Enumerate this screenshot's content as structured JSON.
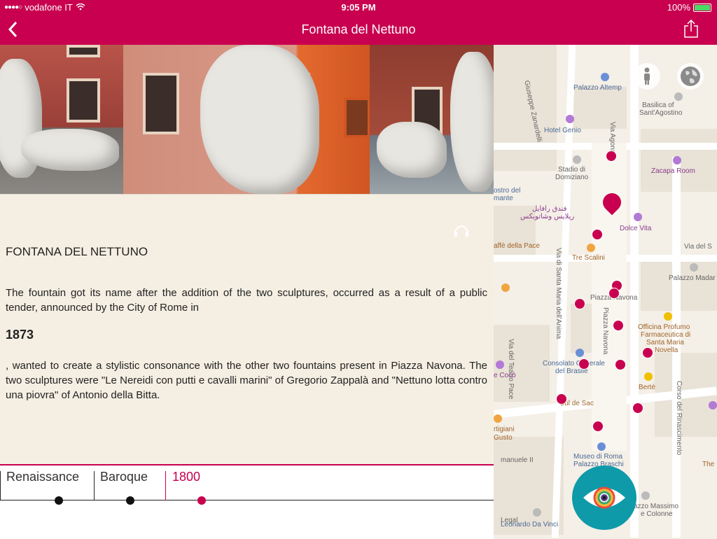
{
  "status": {
    "carrier": "vodafone IT",
    "time": "9:05 PM",
    "battery": "100%",
    "battery_level": 1.0
  },
  "nav": {
    "back_icon": "chevron-left-icon",
    "title": "Fontana del Nettuno",
    "share_icon": "share-icon"
  },
  "content": {
    "heading": "FONTANA DEL NETTUNO",
    "para1": "The fountain got its name after the addition of the two sculptures, occurred as a result of a public tender, announced by the City of Rome in",
    "year": "1873",
    "para2": ", wanted to create a stylistic consonance with the other two fountains present in Piazza Navona. The two sculptures were \"Le Nereidi con putti e cavalli marini\" of Gregorio Zappalà and \"Nettuno lotta contro una piovra\" of Antonio della Bitta."
  },
  "timeline": {
    "periods": [
      {
        "label": "Renaissance",
        "active": false
      },
      {
        "label": "Baroque",
        "active": false
      },
      {
        "label": "1800",
        "active": true
      }
    ]
  },
  "map": {
    "labels": {
      "palazzo_altemps": "Palazzo Altemp",
      "basilica": "Basilica of",
      "basilica2": "Sant'Agostino",
      "hotel_genio": "Hotel Genio",
      "stadio": "Stadio di",
      "stadio2": "Domiziano",
      "zacapa": "Zacapa Room",
      "museo_nostro": "ostro del",
      "museo_nostro2": "mante",
      "arabic1": "فندق رافايل",
      "arabic2": "ريلايس وشاتوبكس",
      "dolce_vita": "Dolce Vita",
      "caffe_pace": "affè della Pace",
      "tre_scalini": "Tre Scalini",
      "via_del_s": "Via del S",
      "palazzo_madama": "Palazzo Madar",
      "piazza_navona": "Piazza Navona",
      "officina1": "Officina Profumo",
      "officina2": "Farmaceutica di",
      "officina3": "Santa Maria",
      "officina4": "Novella",
      "consolato1": "Consolato Generale",
      "consolato2": "del Brasile",
      "e_coco": "e Cocò",
      "berte": "Berté",
      "cul_de_sac": "Cul de Sac",
      "artigiani1": "rtigiani",
      "artigiani2": "Gusto",
      "manuele": "manuele II",
      "museo_roma1": "Museo di Roma",
      "museo_roma2": "Palazzo Braschi",
      "the": "The",
      "massimo1": "azzo Massimo",
      "massimo2": "e Colonne",
      "leonardo": "Leonardo Da Vinci",
      "legal": "Legal",
      "via_aponale": "Via Agonale",
      "via_zanardelli": "Giuseppe Zanardelli",
      "via_santa_maria": "Via di Santa Maria dell'Anima",
      "corso_rinascimento": "Corso del Rinascimento",
      "via_teatro_pace": "Via del Teatro Pace",
      "piazza_navona_street": "Piazza Navona"
    },
    "person_icon": "person-icon",
    "globe_icon": "globe-icon"
  },
  "fab": {
    "icon": "eye-icon"
  },
  "colors": {
    "brand": "#c8004f",
    "fab": "#0f9aa9",
    "content_bg": "#f5efe3"
  }
}
